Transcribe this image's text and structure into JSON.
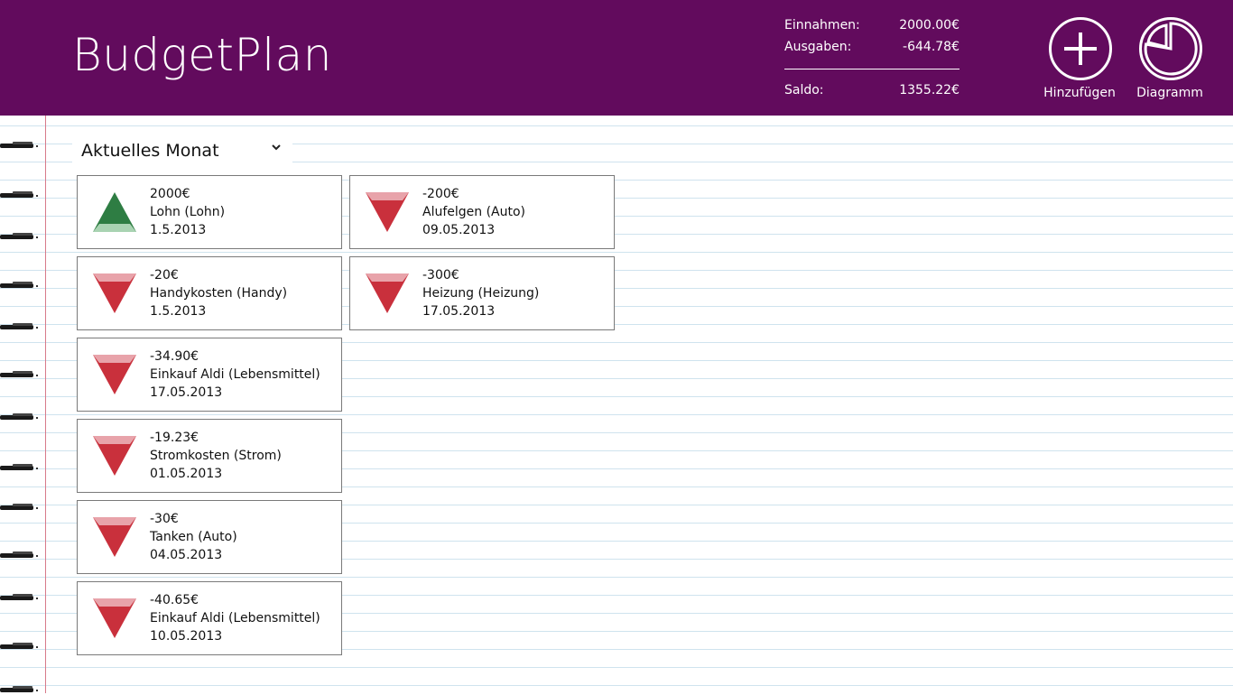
{
  "app": {
    "title": "BudgetPlan"
  },
  "summary": {
    "income_label": "Einnahmen:",
    "income_value": "2000.00€",
    "expenses_label": "Ausgaben:",
    "expenses_value": "-644.78€",
    "balance_label": "Saldo:",
    "balance_value": "1355.22€"
  },
  "actions": {
    "add_label": "Hinzufügen",
    "chart_label": "Diagramm"
  },
  "filter": {
    "selected": "Aktuelles Monat"
  },
  "colors": {
    "header_bg": "#620b5d",
    "income_icon": "#2e7d43",
    "expense_icon": "#c9303c"
  },
  "entries": [
    {
      "type": "income",
      "icon": "arrow-up-icon",
      "amount": "2000€",
      "title": "Lohn (Lohn)",
      "date": "1.5.2013"
    },
    {
      "type": "expense",
      "icon": "arrow-down-icon",
      "amount": "-200€",
      "title": "Alufelgen (Auto)",
      "date": "09.05.2013"
    },
    {
      "type": "expense",
      "icon": "arrow-down-icon",
      "amount": "-20€",
      "title": "Handykosten (Handy)",
      "date": "1.5.2013"
    },
    {
      "type": "expense",
      "icon": "arrow-down-icon",
      "amount": "-300€",
      "title": "Heizung (Heizung)",
      "date": "17.05.2013"
    },
    {
      "type": "expense",
      "icon": "arrow-down-icon",
      "amount": "-34.90€",
      "title": "Einkauf Aldi (Lebensmittel)",
      "date": "17.05.2013"
    },
    {
      "type": "expense",
      "icon": "arrow-down-icon",
      "amount": "-19.23€",
      "title": "Stromkosten (Strom)",
      "date": "01.05.2013"
    },
    {
      "type": "expense",
      "icon": "arrow-down-icon",
      "amount": "-30€",
      "title": "Tanken (Auto)",
      "date": "04.05.2013"
    },
    {
      "type": "expense",
      "icon": "arrow-down-icon",
      "amount": "-40.65€",
      "title": "Einkauf Aldi (Lebensmittel)",
      "date": "10.05.2013"
    }
  ]
}
